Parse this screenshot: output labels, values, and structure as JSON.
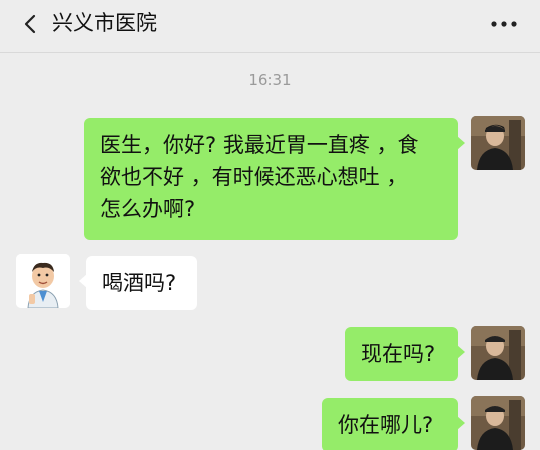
{
  "header": {
    "title": "兴义市医院",
    "back_icon": "chevron-left-icon",
    "more_icon": "ellipsis-icon"
  },
  "timestamp": "16:31",
  "messages": [
    {
      "direction": "outgoing",
      "lines": [
        "医生，你好? 我最近胃一直疼 ，食",
        "欲也不好 ，有时候还恶心想吐 ，",
        "怎么办啊?"
      ]
    },
    {
      "direction": "incoming",
      "lines": [
        "喝酒吗?"
      ]
    },
    {
      "direction": "outgoing",
      "lines": [
        "现在吗?"
      ]
    },
    {
      "direction": "outgoing",
      "lines": [
        "你在哪儿?"
      ]
    }
  ],
  "colors": {
    "background": "#ededed",
    "outgoing_bubble": "#95ec69",
    "incoming_bubble": "#ffffff"
  },
  "avatars": {
    "user": "user-photo-avatar",
    "doctor": "doctor-cartoon-avatar"
  }
}
